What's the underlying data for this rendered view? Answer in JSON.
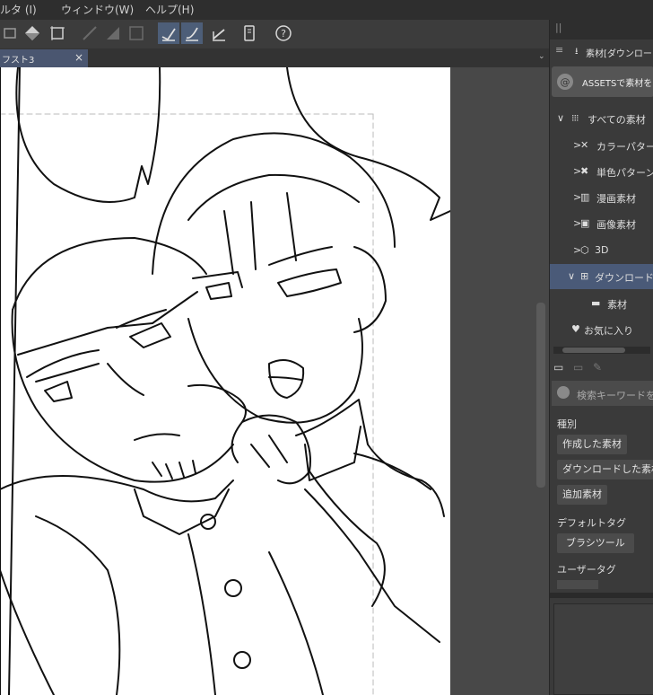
{
  "menu": {
    "items": [
      "ルタ (I)",
      "ウィンドウ(W)",
      "ヘルプ(H)"
    ]
  },
  "toolbar": {
    "icons": [
      "layer-icon",
      "fill-icon",
      "crop-icon",
      "pen-icon",
      "ruler-icon",
      "frame-icon",
      "stabilizer-icon",
      "brush-icon",
      "pen-tool-icon",
      "memo-icon",
      "help-icon"
    ]
  },
  "document": {
    "tab_title": "フスト3",
    "close_glyph": "×"
  },
  "material_panel": {
    "header": "素材[ダウンロード",
    "asset_button": "ASSETSで素材を",
    "tree": [
      {
        "label": "すべての素材",
        "arrow": "∨",
        "icon": "grid-icon"
      },
      {
        "label": "カラーパターン",
        "arrow": ">",
        "icon": "color-pattern-icon"
      },
      {
        "label": "単色パターン",
        "arrow": ">",
        "icon": "mono-pattern-icon"
      },
      {
        "label": "漫画素材",
        "arrow": ">",
        "icon": "manga-material-icon"
      },
      {
        "label": "画像素材",
        "arrow": ">",
        "icon": "image-material-icon"
      },
      {
        "label": "3D",
        "arrow": ">",
        "icon": "cube-icon"
      },
      {
        "label": "ダウンロード",
        "arrow": "∨",
        "icon": "download-icon"
      },
      {
        "label": "素材",
        "arrow": "",
        "icon": "folder-icon"
      },
      {
        "label": "お気に入り",
        "arrow": "",
        "icon": "heart-icon"
      }
    ],
    "search_placeholder": "検索キーワードを",
    "kind_label": "種別",
    "kind_chips": [
      "作成した素材",
      "ダウンロードした素材",
      "追加素材"
    ],
    "default_label": "デフォルトタグ",
    "default_chips": [
      "ブラシツール"
    ],
    "user_tag_label": "ユーザータグ"
  },
  "colors": {
    "menubar": "#2e2e2e",
    "toolbar": "#3c3c3c",
    "panel": "#3a3a3a",
    "selected": "#4a5a78",
    "canvas": "#ffffff",
    "workspace": "#484848"
  }
}
